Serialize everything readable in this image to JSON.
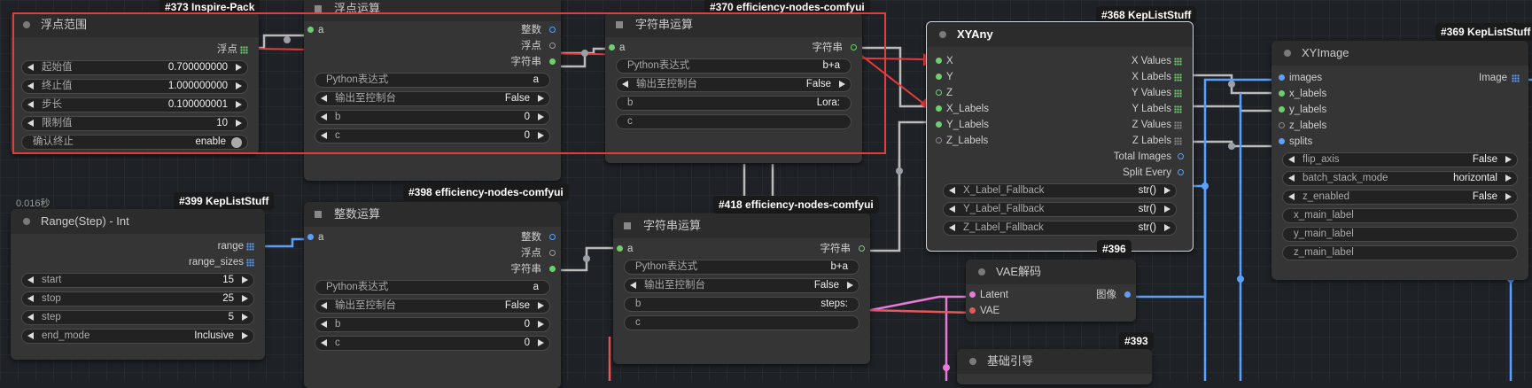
{
  "nodes": {
    "float_range": {
      "badge": "#373 Inspire-Pack",
      "title": "浮点范围",
      "out_float": "浮点",
      "widgets": [
        {
          "label": "起始值",
          "value": "0.700000000"
        },
        {
          "label": "终止值",
          "value": "1.000000000"
        },
        {
          "label": "步长",
          "value": "0.100000001"
        },
        {
          "label": "限制值",
          "value": "10"
        }
      ],
      "toggle": {
        "label": "确认终止",
        "value": "enable"
      }
    },
    "float_op": {
      "title": "浮点运算",
      "in_a": "a",
      "outs": [
        "整数",
        "浮点",
        "字符串"
      ],
      "python_label": "Python表达式",
      "python_value": "a",
      "console_label": "输出至控制台",
      "console_value": "False",
      "b_label": "b",
      "b_value": "0",
      "c_label": "c",
      "c_value": "0"
    },
    "str_op_370": {
      "badge": "#370 efficiency-nodes-comfyui",
      "title": "字符串运算",
      "in_a": "a",
      "out": "字符串",
      "python_label": "Python表达式",
      "python_value": "b+a",
      "console_label": "输出至控制台",
      "console_value": "False",
      "b_label": "b",
      "b_value": "Lora:",
      "c_label": "c"
    },
    "range_step": {
      "badge": "#399 KepListStuff",
      "time": "0.016秒",
      "title": "Range(Step) - Int",
      "out_range": "range",
      "out_sizes": "range_sizes",
      "widgets": [
        {
          "label": "start",
          "value": "15"
        },
        {
          "label": "stop",
          "value": "25"
        },
        {
          "label": "step",
          "value": "5"
        },
        {
          "label": "end_mode",
          "value": "Inclusive"
        }
      ]
    },
    "int_op": {
      "badge": "#398 efficiency-nodes-comfyui",
      "title": "整数运算",
      "in_a": "a",
      "outs": [
        "整数",
        "浮点",
        "字符串"
      ],
      "python_label": "Python表达式",
      "python_value": "a",
      "console_label": "输出至控制台",
      "console_value": "False",
      "b_label": "b",
      "b_value": "0",
      "c_label": "c",
      "c_value": "0"
    },
    "str_op_418": {
      "badge": "#418 efficiency-nodes-comfyui",
      "title": "字符串运算",
      "in_a": "a",
      "out": "字符串",
      "python_label": "Python表达式",
      "python_value": "b+a",
      "console_label": "输出至控制台",
      "console_value": "False",
      "b_label": "b",
      "b_value": "steps:",
      "c_label": "c"
    },
    "xyany": {
      "badge": "#368 KepListStuff",
      "title": "XYAny",
      "inputs": [
        "X",
        "Y",
        "Z",
        "X_Labels",
        "Y_Labels",
        "Z_Labels"
      ],
      "outputs": [
        "X Values",
        "X Labels",
        "Y Values",
        "Y Labels",
        "Z Values",
        "Z Labels",
        "Total Images",
        "Split Every"
      ],
      "fallbacks": [
        {
          "label": "X_Label_Fallback",
          "value": "str()"
        },
        {
          "label": "Y_Label_Fallback",
          "value": "str()"
        },
        {
          "label": "Z_Label_Fallback",
          "value": "str()"
        }
      ]
    },
    "xyimage": {
      "badge": "#369 KepListStuff",
      "title": "XYImage",
      "inputs": [
        "images",
        "x_labels",
        "y_labels",
        "z_labels",
        "splits"
      ],
      "out": "Image",
      "widgets": [
        {
          "label": "flip_axis",
          "value": "False"
        },
        {
          "label": "batch_stack_mode",
          "value": "horizontal"
        },
        {
          "label": "z_enabled",
          "value": "False"
        }
      ],
      "texts": [
        "x_main_label",
        "y_main_label",
        "z_main_label"
      ]
    },
    "vae": {
      "badge": "#396",
      "title": "VAE解码",
      "in_latent": "Latent",
      "in_vae": "VAE",
      "out": "图像"
    },
    "guide": {
      "badge": "#393",
      "title": "基础引导"
    }
  },
  "colors": {
    "canvas": "#1e2226",
    "node": "#353535",
    "highlight": "#e53b3b",
    "wire_blue": "#5aa0ff",
    "wire_pink": "#e87ad8",
    "wire_red": "#e05a5a"
  }
}
